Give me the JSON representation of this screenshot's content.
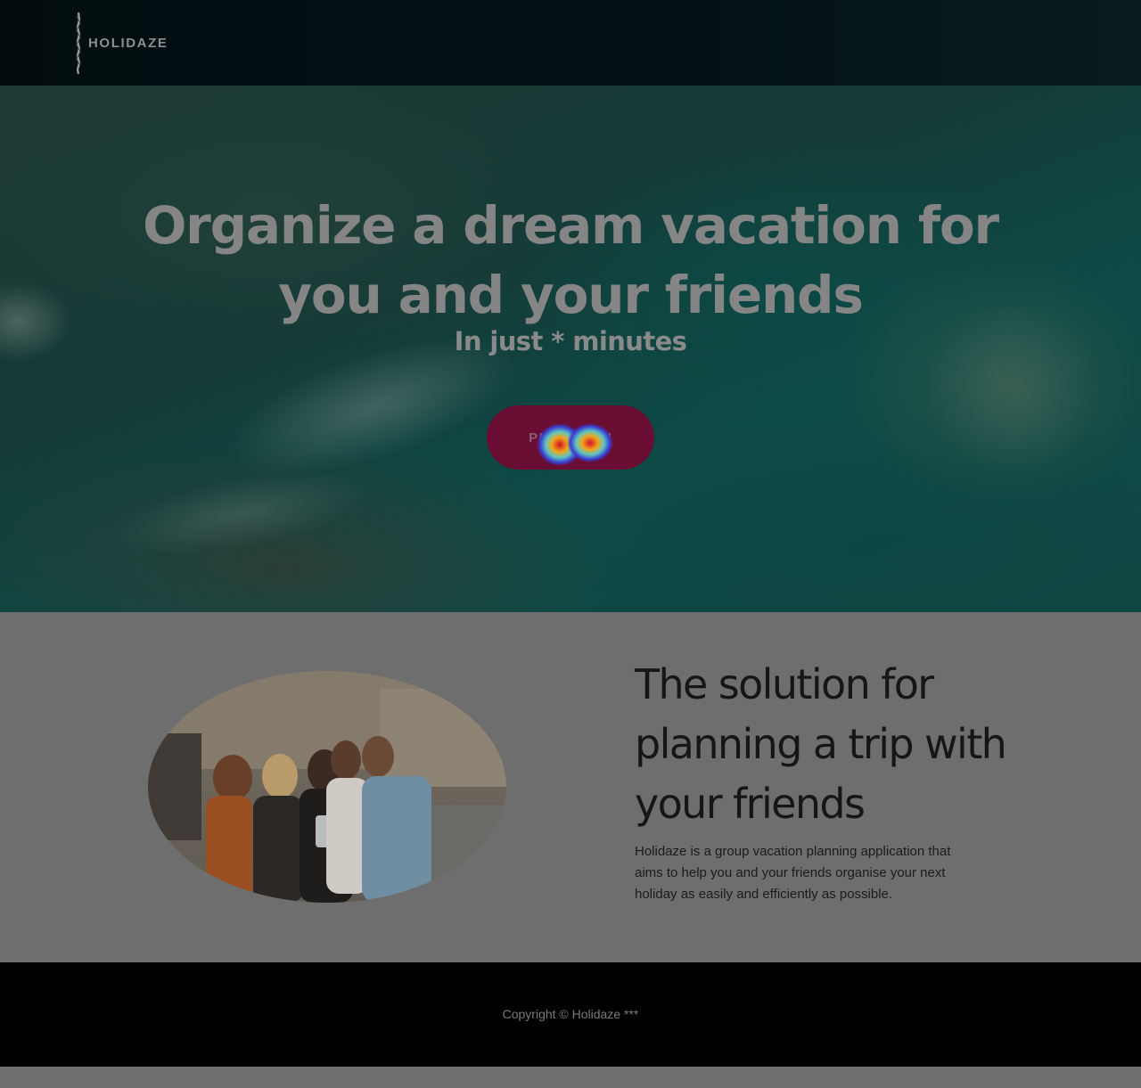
{
  "navbar": {
    "brand": "HOLIDAZE",
    "logo_icon": "brush-stroke-logo-icon"
  },
  "hero": {
    "title": "Organize a dream vacation for you and your friends",
    "subtitle": "In just * minutes",
    "cta_label": "PLAN NOW"
  },
  "about": {
    "image_icon": "friends-group-photo",
    "title": "The solution for planning a trip with your friends",
    "text": "Holidaze is a group vacation planning application that aims to help you and your friends organise your next holiday as easily and efficiently as possible."
  },
  "footer": {
    "copyright": "Copyright © Holidaze ***"
  },
  "colors": {
    "navbar_bg": "#041216",
    "cta_bg": "#6a0d33",
    "overlay_gray": "#6e6e6e",
    "footer_bg": "#000000"
  }
}
